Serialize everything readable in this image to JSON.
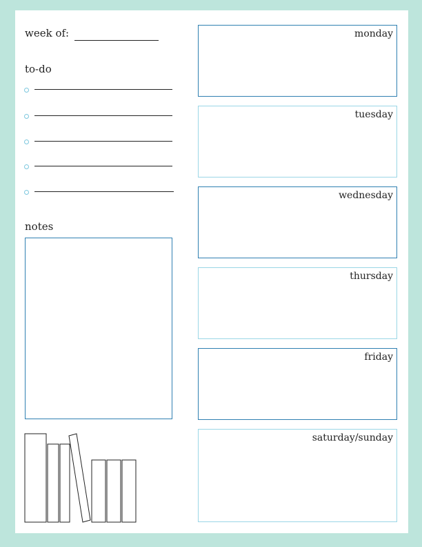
{
  "header": {
    "week_label": "week of:"
  },
  "todo": {
    "title": "to-do",
    "items": [
      "",
      "",
      "",
      "",
      ""
    ]
  },
  "notes": {
    "title": "notes"
  },
  "days": [
    {
      "label": "monday",
      "style": "dark"
    },
    {
      "label": "tuesday",
      "style": "light"
    },
    {
      "label": "wednesday",
      "style": "dark"
    },
    {
      "label": "thursday",
      "style": "light"
    },
    {
      "label": "friday",
      "style": "dark"
    },
    {
      "label": "saturday/sunday",
      "style": "light"
    }
  ],
  "colors": {
    "background": "#bde5dc",
    "accent_dark": "#2e7fb1",
    "accent_light": "#9ad6e6",
    "bullet": "#7cc7de"
  },
  "icons": {
    "books": "books-illustration-icon",
    "bullet": "circle-bullet-icon"
  }
}
